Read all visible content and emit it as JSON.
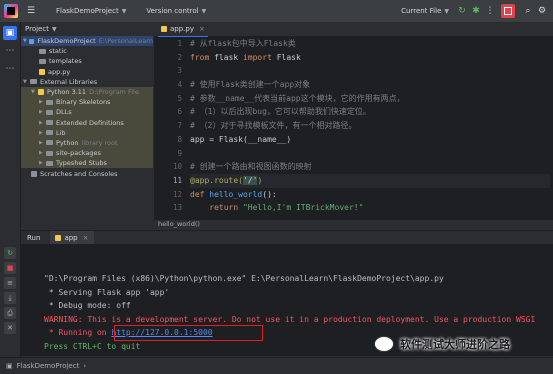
{
  "titlebar": {
    "project": "FlaskDemoProject",
    "vcs": "Version control",
    "run_config": "Current File",
    "accent": "#3574f0",
    "stop_color": "#e0434e"
  },
  "project_panel": {
    "header": "Project",
    "rows": [
      {
        "label": "FlaskDemoProject",
        "extra": "E:\\PersonalLearn"
      },
      {
        "label": "static"
      },
      {
        "label": "templates"
      },
      {
        "label": "app.py"
      },
      {
        "label": "External Libraries"
      },
      {
        "label": "Python 3.11",
        "extra": "D:\\Program File"
      },
      {
        "label": "Binary Skeletons"
      },
      {
        "label": "DLLs"
      },
      {
        "label": "Extended Definitions"
      },
      {
        "label": "Lib"
      },
      {
        "label": "Python",
        "extra": "library root"
      },
      {
        "label": "site-packages"
      },
      {
        "label": "Typeshed Stubs"
      },
      {
        "label": "Scratches and Consoles"
      }
    ]
  },
  "editor": {
    "tab": "app.py",
    "breadcrumb": "hello_world()",
    "line_numbers": [
      "1",
      "2",
      "3",
      "4",
      "5",
      "6",
      "7",
      "8",
      "9",
      "10",
      "11",
      "12",
      "13"
    ],
    "lines": {
      "l1": "# 从flask包中导入Flask类",
      "l2a": "from",
      "l2b": " flask ",
      "l2c": "import",
      "l2d": " Flask",
      "l4": "# 使用Flask类创建一个app对象",
      "l5": "# 参数__name__代表当前app这个模块，它的作用有两点，",
      "l6": "# （1）以后出现bug，它可以帮助我们快速定位。",
      "l7": "# （2）对于寻找模板文件，有一个相对路径。",
      "l8": "app = Flask(__name__)",
      "l10": "# 创建一个路由和视图函数的映射",
      "l11a": "@app.route(",
      "l11b": "'/'",
      "l11c": ")",
      "l12a": "def",
      "l12b": " hello_world",
      "l12c": "():",
      "l13a": "    return ",
      "l13b": "\"Hello,I'm ITBrickMover!\""
    }
  },
  "run": {
    "label": "Run",
    "tab": "app",
    "console": {
      "c1": "\"D:\\Program Files (x86)\\Python\\python.exe\" E:\\PersonalLearn\\FlaskDemoProject\\app.py",
      "c2": " * Serving Flask app 'app'",
      "c3": " * Debug mode: off",
      "c4": "WARNING: This is a development server. Do not use it in a production deployment. Use a production WSGI",
      "c5a": " * Running on ",
      "c5b": "http://127.0.0.1:5000",
      "c6": "Press CTRL+C to quit"
    }
  },
  "status": {
    "project": "FlaskDemoProject",
    "watermark": "软件测试大师进阶之路"
  }
}
